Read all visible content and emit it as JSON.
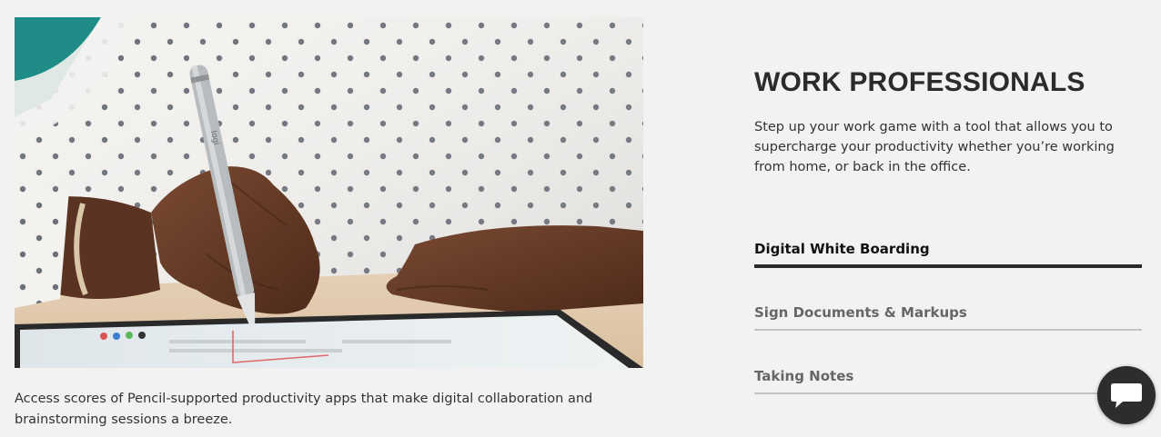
{
  "hero": {
    "image_alt": "Hand writing on a tablet with a stylus pencil",
    "pen_logo": "logi",
    "caption": "Access scores of Pencil-supported productivity apps that make digital collaboration and brainstorming sessions a breeze."
  },
  "section": {
    "title": "WORK PROFESSIONALS",
    "description": "Step up your work game with a tool that allows you to supercharge your productivity whether you’re working from home, or back in the office."
  },
  "tabs": [
    {
      "label": "Digital White Boarding",
      "active": true
    },
    {
      "label": "Sign Documents & Markups",
      "active": false
    },
    {
      "label": "Taking Notes",
      "active": false
    }
  ],
  "chat": {
    "icon": "chat-bubble-icon"
  },
  "colors": {
    "background": "#f2f2f2",
    "text": "#2b2b2b",
    "tab_active_rule": "#2b2b2b",
    "tab_inactive_rule": "#c3c3c3",
    "chat_bg": "#2d2d2d"
  }
}
